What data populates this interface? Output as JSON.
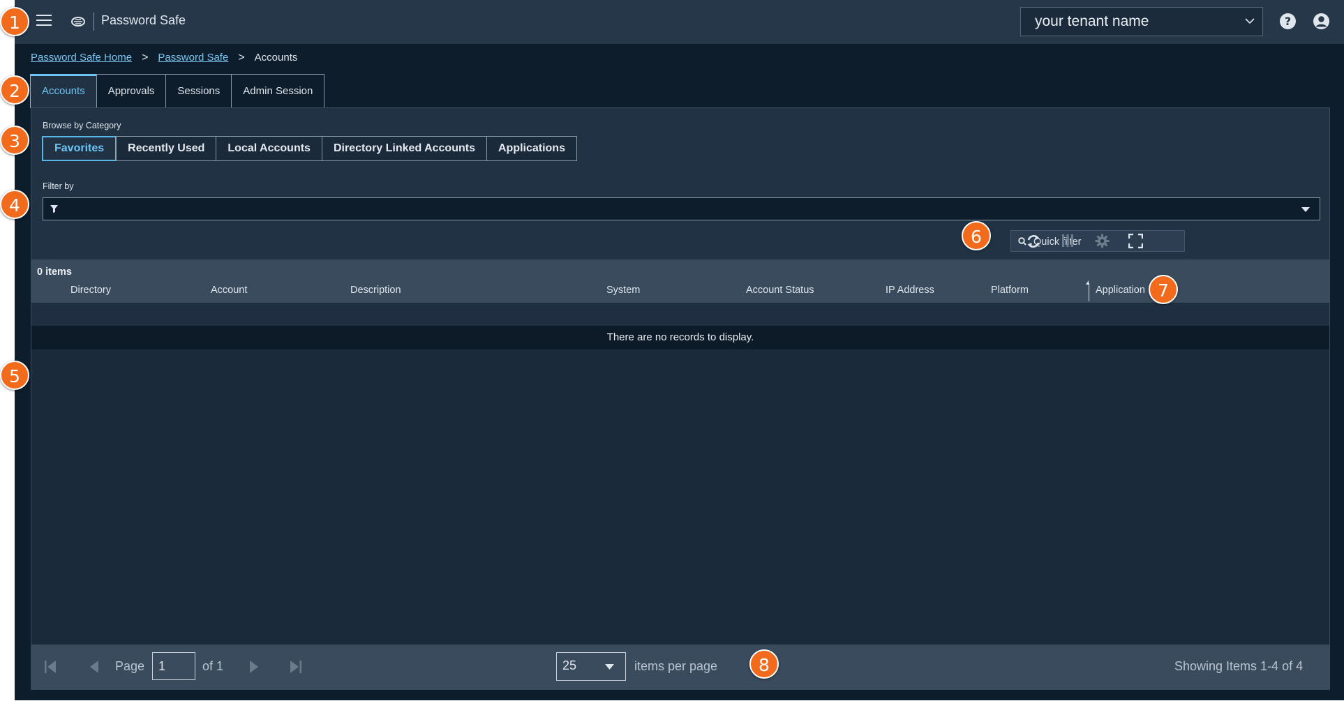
{
  "header": {
    "app_title": "Password Safe",
    "tenant": "your tenant name",
    "icons": [
      "hamburger-menu-icon",
      "beyondtrust-logo-icon",
      "chevron-down-icon",
      "help-icon",
      "user-account-icon"
    ]
  },
  "breadcrumb": {
    "items": [
      "Password Safe Home",
      "Password Safe"
    ],
    "current": "Accounts",
    "separator": ">"
  },
  "tabs": [
    {
      "label": "Accounts",
      "active": true
    },
    {
      "label": "Approvals"
    },
    {
      "label": "Sessions"
    },
    {
      "label": "Admin Session"
    }
  ],
  "browse": {
    "label": "Browse by Category",
    "categories": [
      {
        "label": "Favorites",
        "active": true
      },
      {
        "label": "Recently Used"
      },
      {
        "label": "Local Accounts"
      },
      {
        "label": "Directory Linked Accounts"
      },
      {
        "label": "Applications"
      }
    ]
  },
  "filter": {
    "label": "Filter by",
    "value": ""
  },
  "toolbar": {
    "quick_filter_placeholder": "Quick filter",
    "icons": [
      "refresh-icon",
      "columns-icon",
      "settings-icon",
      "fullscreen-icon"
    ]
  },
  "grid": {
    "items_count": "0 items",
    "columns": [
      "Directory",
      "Account",
      "Description",
      "System",
      "Account Status",
      "IP Address",
      "Platform",
      "Application"
    ],
    "empty_message": "There are no records to display."
  },
  "pager": {
    "page_label": "Page",
    "page_value": "1",
    "of_label": "of 1",
    "per_page_value": "25",
    "per_page_label": "items per page",
    "showing": "Showing Items 1-4 of 4"
  },
  "callouts": [
    "1",
    "2",
    "3",
    "4",
    "5",
    "6",
    "7",
    "8"
  ],
  "colors": {
    "accent": "#6cc4f2",
    "callout": "#f26a1b",
    "background": "#0e1d2c",
    "panel": "#213244"
  }
}
